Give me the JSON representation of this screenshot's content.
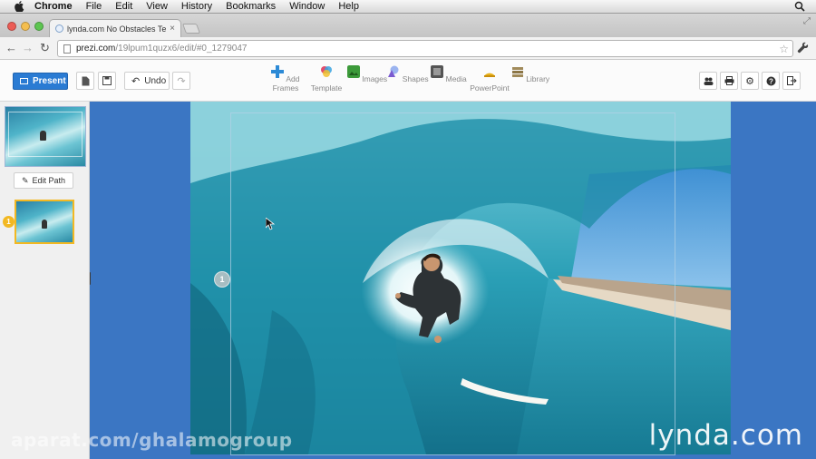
{
  "menubar": {
    "app_name": "Chrome",
    "items": [
      "File",
      "Edit",
      "View",
      "History",
      "Bookmarks",
      "Window",
      "Help"
    ]
  },
  "browser": {
    "tab_title": "lynda.com No Obstacles Ten",
    "url_host": "prezi.com",
    "url_path": "/19lpum1quzx6/edit/#0_1279047"
  },
  "prezi_toolbar": {
    "present_label": "Present",
    "undo_label": "Undo",
    "tools": [
      {
        "label": "Add Frames",
        "icon": "plus-icon",
        "color": "#2c8ad6"
      },
      {
        "label": "Template",
        "icon": "palette-icon",
        "color": "#d44b7a"
      },
      {
        "label": "Images",
        "icon": "image-icon",
        "color": "#3c9a3a"
      },
      {
        "label": "Shapes",
        "icon": "shapes-icon",
        "color": "#8a7ad8"
      },
      {
        "label": "Media",
        "icon": "film-icon",
        "color": "#666666"
      },
      {
        "label": "PowerPoint",
        "icon": "powerpoint-icon",
        "color": "#e8b21c"
      },
      {
        "label": "Library",
        "icon": "library-icon",
        "color": "#a08a5a"
      }
    ]
  },
  "sidebar": {
    "edit_path_label": "Edit Path",
    "path_steps": [
      {
        "number": "1"
      }
    ]
  },
  "canvas": {
    "frame_number": "1",
    "accent_color": "#3b76c3"
  },
  "watermarks": {
    "left": "aparat.com/ghalamogroup",
    "right_brand": "lynda",
    "right_dot": ".",
    "right_tld": "com"
  }
}
